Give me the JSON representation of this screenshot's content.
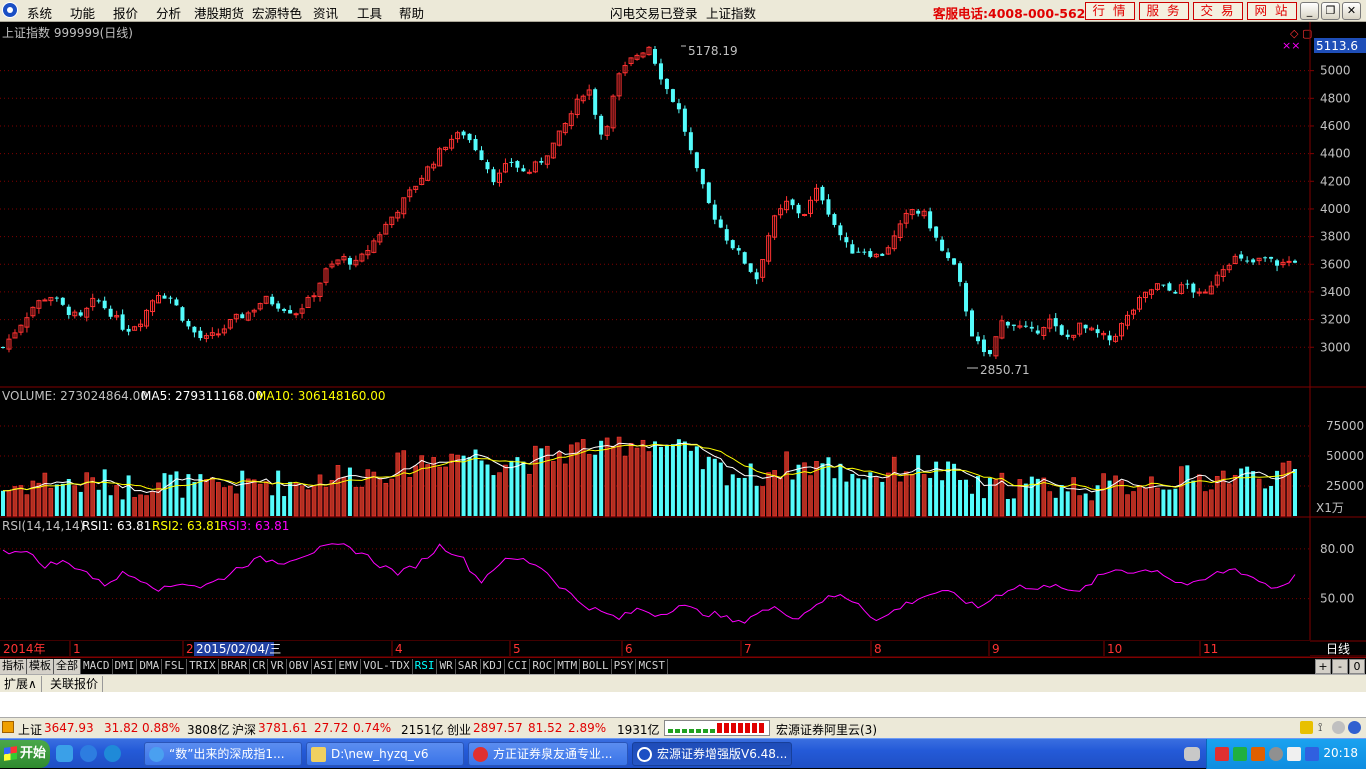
{
  "menu": {
    "items": [
      "系统",
      "功能",
      "报价",
      "分析",
      "港股期货",
      "宏源特色",
      "资讯",
      "工具",
      "帮助"
    ],
    "center_left": "闪电交易已登录",
    "center_right": "上证指数",
    "phone": "客服电话:4008-000-562",
    "buttons": [
      "行情",
      "服务",
      "交易",
      "网站"
    ]
  },
  "chart_header": {
    "title": "上证指数 999999(日线)",
    "price_tag": "5113.6",
    "high_label": "5178.19",
    "low_label": "2850.71",
    "marker_symbol": "×× "
  },
  "volume_header": {
    "label": "VOLUME: 273024864.00",
    "ma5": "MA5: 279311168.00",
    "ma10": "MA10: 306148160.00",
    "unit": "X1万"
  },
  "rsi_header": {
    "label": "RSI(14,14,14)",
    "rsi1": "RSI1: 63.81",
    "rsi2": "RSI2: 63.81",
    "rsi3": "RSI3: 63.81"
  },
  "time_axis": {
    "first": "2014年",
    "highlight": "2015/02/04/三",
    "months": [
      "1",
      "2",
      "4",
      "5",
      "6",
      "7",
      "8",
      "9",
      "10",
      "11"
    ],
    "period": "日线"
  },
  "colors": {
    "up": "#ff3232",
    "down": "#54fcfc",
    "grid": "#800000",
    "ma5": "#ffffff",
    "ma10": "#ffff00",
    "rsi_line": "#ff00ff"
  },
  "chart_data": [
    {
      "type": "candlestick",
      "title": "上证指数 999999(日线)",
      "x_start": "2014年",
      "x_months": [
        "1",
        "2",
        "4",
        "5",
        "6",
        "7",
        "8",
        "9",
        "10",
        "11"
      ],
      "yticks": [
        "5000",
        "4800",
        "4600",
        "4400",
        "4200",
        "4000",
        "3800",
        "3600",
        "3400",
        "3200",
        "3000"
      ],
      "ylim": [
        2850,
        5178.19
      ],
      "close_path": [
        3000,
        3150,
        3300,
        3380,
        3280,
        3200,
        3350,
        3250,
        3120,
        3200,
        3400,
        3350,
        3150,
        3050,
        3100,
        3200,
        3250,
        3350,
        3300,
        3250,
        3350,
        3550,
        3650,
        3600,
        3750,
        3900,
        4050,
        4200,
        4350,
        4500,
        4550,
        4400,
        4200,
        4350,
        4250,
        4350,
        4500,
        4700,
        4900,
        4500,
        4950,
        5100,
        5178,
        4900,
        4700,
        4300,
        4000,
        3800,
        3650,
        3500,
        3900,
        4050,
        3950,
        4150,
        3900,
        3700,
        3700,
        3650,
        3800,
        4000,
        3950,
        3700,
        3550,
        3100,
        2900,
        3200,
        3150,
        3100,
        3200,
        3050,
        3150,
        3100,
        3050,
        3200,
        3350,
        3450,
        3400,
        3450,
        3350,
        3550,
        3650,
        3600,
        3640,
        3600,
        3630
      ],
      "high_label": "5178.19",
      "low_label": "2850.71"
    },
    {
      "type": "bar",
      "title": "VOLUME",
      "yticks": [
        "75000",
        "50000",
        "25000"
      ],
      "unit": "X1万",
      "series": [
        {
          "name": "VOLUME",
          "last": 273024864.0
        },
        {
          "name": "MA5",
          "last": 279311168.0
        },
        {
          "name": "MA10",
          "last": 306148160.0
        }
      ]
    },
    {
      "type": "line",
      "title": "RSI(14,14,14)",
      "yticks": [
        "80.00",
        "50.00"
      ],
      "series": [
        {
          "name": "RSI1",
          "last": 63.81
        },
        {
          "name": "RSI2",
          "last": 63.81
        },
        {
          "name": "RSI3",
          "last": 63.81
        }
      ],
      "values": [
        78,
        80,
        70,
        72,
        68,
        58,
        65,
        62,
        55,
        60,
        57,
        62,
        70,
        74,
        72,
        76,
        80,
        82,
        78,
        70,
        65,
        72,
        82,
        76,
        60,
        72,
        74,
        70,
        58,
        48,
        42,
        38,
        44,
        40,
        46,
        42,
        40,
        35,
        42,
        44,
        38,
        48,
        52,
        48,
        36,
        44,
        50,
        54,
        52,
        44,
        52,
        58,
        55,
        60,
        52,
        62,
        68,
        66,
        68,
        60,
        58,
        65,
        68,
        62,
        56,
        63
      ]
    }
  ],
  "tabs": {
    "cn": [
      "指标",
      "模板",
      "全部"
    ],
    "indicators": [
      "MACD",
      "DMI",
      "DMA",
      "FSL",
      "TRIX",
      "BRAR",
      "CR",
      "VR",
      "OBV",
      "ASI",
      "EMV",
      "VOL-TDX",
      "RSI",
      "WR",
      "SAR",
      "KDJ",
      "CCI",
      "ROC",
      "MTM",
      "BOLL",
      "PSY",
      "MCST"
    ],
    "active": "RSI",
    "controls": [
      "+",
      "-",
      "0"
    ]
  },
  "subbar": {
    "items": [
      "扩展∧",
      "关联报价"
    ]
  },
  "status": {
    "sh_label": "上证",
    "sh_price": "3647.93",
    "sh_change": "31.82",
    "sh_pct": "0.88%",
    "sh_vol": "3808亿",
    "sz_label": "沪深",
    "sz_price": "3781.61",
    "sz_change": "27.72",
    "sz_pct": "0.74%",
    "sz_vol": "2151亿",
    "cy_label": "创业",
    "cy_price": "2897.57",
    "cy_change": "81.52",
    "cy_pct": "2.89%",
    "cy_vol": "1931亿",
    "broker": "宏源证券阿里云(3)"
  },
  "taskbar": {
    "start": "开始",
    "windows": [
      "“数”出来的深成指1...",
      "D:\\new_hyzq_v6",
      "方正证券泉友通专业...",
      "宏源证券增强版V6.48..."
    ],
    "clock": "20:18"
  }
}
